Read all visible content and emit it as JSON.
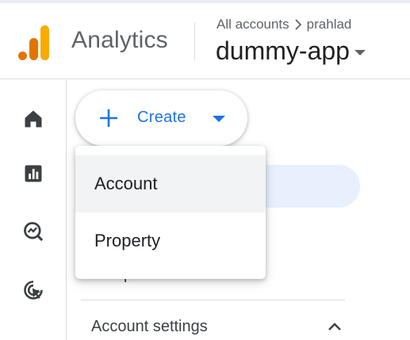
{
  "header": {
    "brand": "Analytics",
    "breadcrumb_root": "All accounts",
    "breadcrumb_account": "prahlad",
    "property_name": "dummy-app"
  },
  "rail": {
    "items": [
      {
        "icon": "home-icon"
      },
      {
        "icon": "reports-icon"
      },
      {
        "icon": "explore-icon"
      },
      {
        "icon": "advertising-icon"
      }
    ]
  },
  "create_button": {
    "label": "Create"
  },
  "create_menu": {
    "items": [
      {
        "label": "Account"
      },
      {
        "label": "Property"
      }
    ]
  },
  "nav": {
    "partial_item_text": "p",
    "section_title": "Account settings"
  },
  "colors": {
    "accent": "#1a73e8",
    "logo_orange_dark": "#e37400",
    "logo_orange_light": "#f9ab00",
    "selected_bg": "#e8f0fe"
  }
}
